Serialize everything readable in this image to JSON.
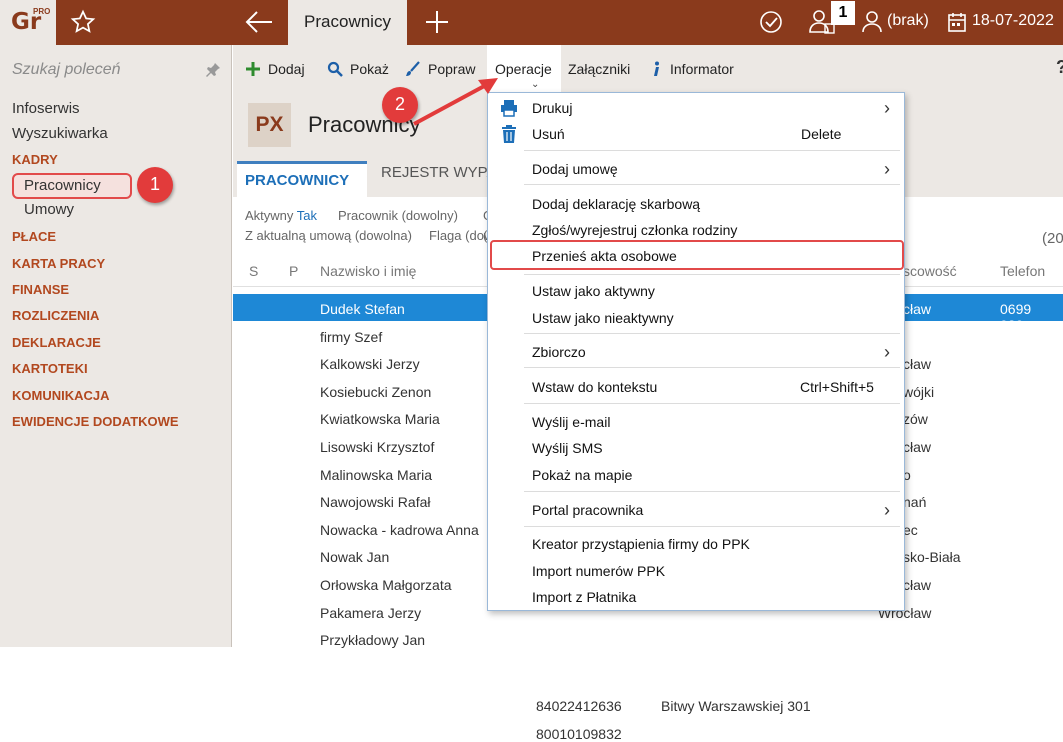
{
  "app": {
    "logo_text": "Gr",
    "logo_badge": "PRO",
    "active_tab": "Pracownicy",
    "users_count": "1",
    "user_label": "(brak)",
    "date": "18-07-2022"
  },
  "sidebar": {
    "search_placeholder": "Szukaj poleceń",
    "items": [
      "Infoserwis",
      "Wyszukiwarka"
    ],
    "kadry": {
      "label": "KADRY",
      "sub": [
        "Pracownicy",
        "Umowy"
      ]
    },
    "sections": [
      "PŁACE",
      "KARTA PRACY",
      "FINANSE",
      "ROZLICZENIA",
      "DEKLARACJE",
      "KARTOTEKI",
      "KOMUNIKACJA",
      "EWIDENCJE DODATKOWE"
    ]
  },
  "toolbar": {
    "add_label": "Dodaj",
    "show_label": "Pokaż",
    "edit_label": "Popraw",
    "operations_label": "Operacje",
    "attachments_label": "Załączniki",
    "info_label": "Informator",
    "more_label": "?"
  },
  "page": {
    "badge": "PX",
    "title": "Pracownicy",
    "tabs": [
      "PRACOWNICY",
      "REJESTR WYPA"
    ]
  },
  "filters": {
    "active_label": "Aktywny",
    "active_value": "Tak",
    "employee_label": "Pracownik (dowolny)",
    "employee_extra": "G",
    "contract_label": "Z aktualną umową (dowolna)",
    "flag_label": "Flaga (dowolna)",
    "flag_extra": "(",
    "count": "(20"
  },
  "grid": {
    "headers": {
      "s": "S",
      "p": "P",
      "name": "Nazwisko i imię",
      "city": "scowość",
      "phone": "Telefon"
    },
    "rows": [
      {
        "name": "Dudek Stefan",
        "city": "cław",
        "phone": "0699 929-"
      },
      {
        "name": "firmy Szef",
        "city": "",
        "phone": ""
      },
      {
        "name": "Kalkowski Jerzy",
        "city": "cław",
        "phone": ""
      },
      {
        "name": "Kosiebucki Zenon",
        "city": "wójki",
        "phone": ""
      },
      {
        "name": "Kwiatkowska Maria",
        "city": "zów",
        "phone": ""
      },
      {
        "name": "Lisowski Krzysztof",
        "city": "cław",
        "phone": ""
      },
      {
        "name": "Malinowska Maria",
        "city": "o",
        "phone": ""
      },
      {
        "name": "Nawojowski Rafał",
        "city": "nań",
        "phone": ""
      },
      {
        "name": "Nowacka - kadrowa Anna",
        "city": "ec",
        "phone": ""
      },
      {
        "name": "Nowak Jan",
        "city": "sko-Biała",
        "phone": ""
      },
      {
        "name": "Orłowska Małgorzata",
        "city": "cław",
        "phone": ""
      },
      {
        "name": "Pakamera Jerzy",
        "city": "Wrocław",
        "phone": ""
      },
      {
        "name": "Przykładowy Jan",
        "city": "",
        "phone": ""
      }
    ],
    "pakamera_pesel": "84022412636",
    "pakamera_street": "Bitwy Warszawskiej 301",
    "przykladowy_pesel": "80010109832"
  },
  "menu": {
    "items": [
      {
        "label": "Drukuj",
        "shortcut": "",
        "submenu": true
      },
      {
        "label": "Usuń",
        "shortcut": "Delete",
        "submenu": false
      },
      {
        "label": "Dodaj umowę",
        "shortcut": "",
        "submenu": true
      },
      {
        "label": "Dodaj deklarację skarbową",
        "shortcut": "",
        "submenu": false
      },
      {
        "label": "Zgłoś/wyrejestruj członka rodziny",
        "shortcut": "",
        "submenu": false
      },
      {
        "label": "Przenieś akta osobowe",
        "shortcut": "",
        "submenu": false
      },
      {
        "label": "Ustaw jako aktywny",
        "shortcut": "",
        "submenu": false
      },
      {
        "label": "Ustaw jako nieaktywny",
        "shortcut": "",
        "submenu": false
      },
      {
        "label": "Zbiorczo",
        "shortcut": "",
        "submenu": true
      },
      {
        "label": "Wstaw do kontekstu",
        "shortcut": "Ctrl+Shift+5",
        "submenu": false
      },
      {
        "label": "Wyślij e-mail",
        "shortcut": "",
        "submenu": false
      },
      {
        "label": "Wyślij SMS",
        "shortcut": "",
        "submenu": false
      },
      {
        "label": "Pokaż na mapie",
        "shortcut": "",
        "submenu": false
      },
      {
        "label": "Portal pracownika",
        "shortcut": "",
        "submenu": true
      },
      {
        "label": "Kreator przystąpienia firmy do PPK",
        "shortcut": "",
        "submenu": false
      },
      {
        "label": "Import numerów PPK",
        "shortcut": "",
        "submenu": false
      },
      {
        "label": "Import z Płatnika",
        "shortcut": "",
        "submenu": false
      }
    ],
    "submenu_arrow": "›"
  },
  "annotations": {
    "step1": "1",
    "step2": "2"
  },
  "colors": {
    "brand": "#8a3a1c",
    "section": "#b2481f",
    "selection": "#1e88d6",
    "link": "#1d6fb8",
    "annotation": "#e23b3b"
  }
}
